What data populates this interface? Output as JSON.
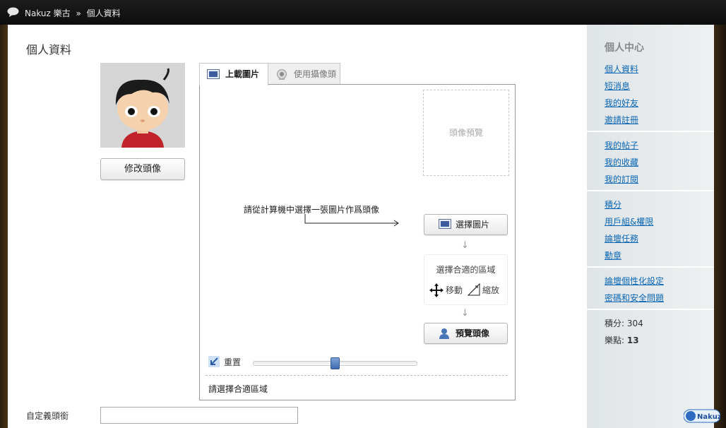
{
  "topbar": {
    "site": "Nakuz 樂古",
    "separator": "»",
    "page": "個人資料"
  },
  "page_title": "個人資料",
  "avatar": {
    "change_button": "修改頭像"
  },
  "upload": {
    "tabs": [
      "上載圖片",
      "使用攝像頭"
    ],
    "preview_placeholder": "頭像預覽",
    "instruction": "請從計算機中選擇一張圖片作爲頭像",
    "select_button": "選擇圖片",
    "area_title": "選擇合適的區域",
    "move_label": "移動",
    "zoom_label": "縮放",
    "preview_button": "預覽頭像",
    "reset_label": "重置",
    "zoom_level": 0.5,
    "status": "請選擇合適區域"
  },
  "custom_title": {
    "label": "自定義頭銜",
    "value": ""
  },
  "sidebar": {
    "title": "個人中心",
    "groups": [
      [
        "個人資料",
        "短消息",
        "我的好友",
        "邀請註冊"
      ],
      [
        "我的帖子",
        "我的收藏",
        "我的訂閱"
      ],
      [
        "積分",
        "用戶組&權限",
        "論壇任務",
        "勳章"
      ],
      [
        "論壇個性化設定",
        "密碼和安全問題"
      ]
    ],
    "stats": {
      "points_label": "積分:",
      "points_value": "304",
      "music_label": "樂點:",
      "music_value": "13"
    }
  },
  "logo_text": "Nakuz"
}
